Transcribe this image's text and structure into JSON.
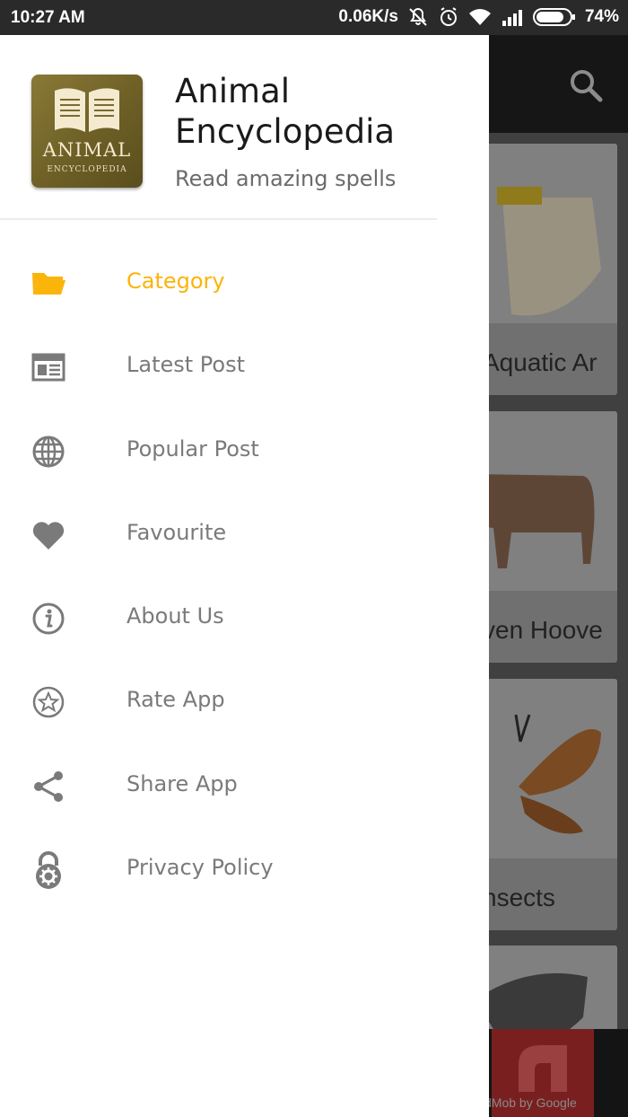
{
  "status_bar": {
    "time": "10:27 AM",
    "network_speed": "0.06K/s",
    "battery": "74%",
    "icons": [
      "mute-icon",
      "alarm-icon",
      "wifi-icon",
      "signal-icon",
      "battery-icon"
    ]
  },
  "drawer": {
    "logo": {
      "line1": "ANIMAL",
      "line2": "ENCYCLOPEDIA"
    },
    "title": "Animal Encyclopedia",
    "subtitle": "Read amazing spells",
    "active_color": "#fbb40a",
    "items": [
      {
        "label": "Category",
        "icon": "folder-icon",
        "active": true
      },
      {
        "label": "Latest Post",
        "icon": "newspaper-icon",
        "active": false
      },
      {
        "label": "Popular Post",
        "icon": "globe-icon",
        "active": false
      },
      {
        "label": "Favourite",
        "icon": "heart-icon",
        "active": false
      },
      {
        "label": "About Us",
        "icon": "info-icon",
        "active": false
      },
      {
        "label": "Rate App",
        "icon": "star-icon",
        "active": false
      },
      {
        "label": "Share App",
        "icon": "share-icon",
        "active": false
      },
      {
        "label": "Privacy Policy",
        "icon": "lock-icon",
        "active": false
      }
    ]
  },
  "background": {
    "cards": [
      {
        "label": "Aquatic Ar"
      },
      {
        "label": "ven Hoove"
      },
      {
        "label": "nsects"
      }
    ],
    "ad_text": "dMob by Google"
  }
}
